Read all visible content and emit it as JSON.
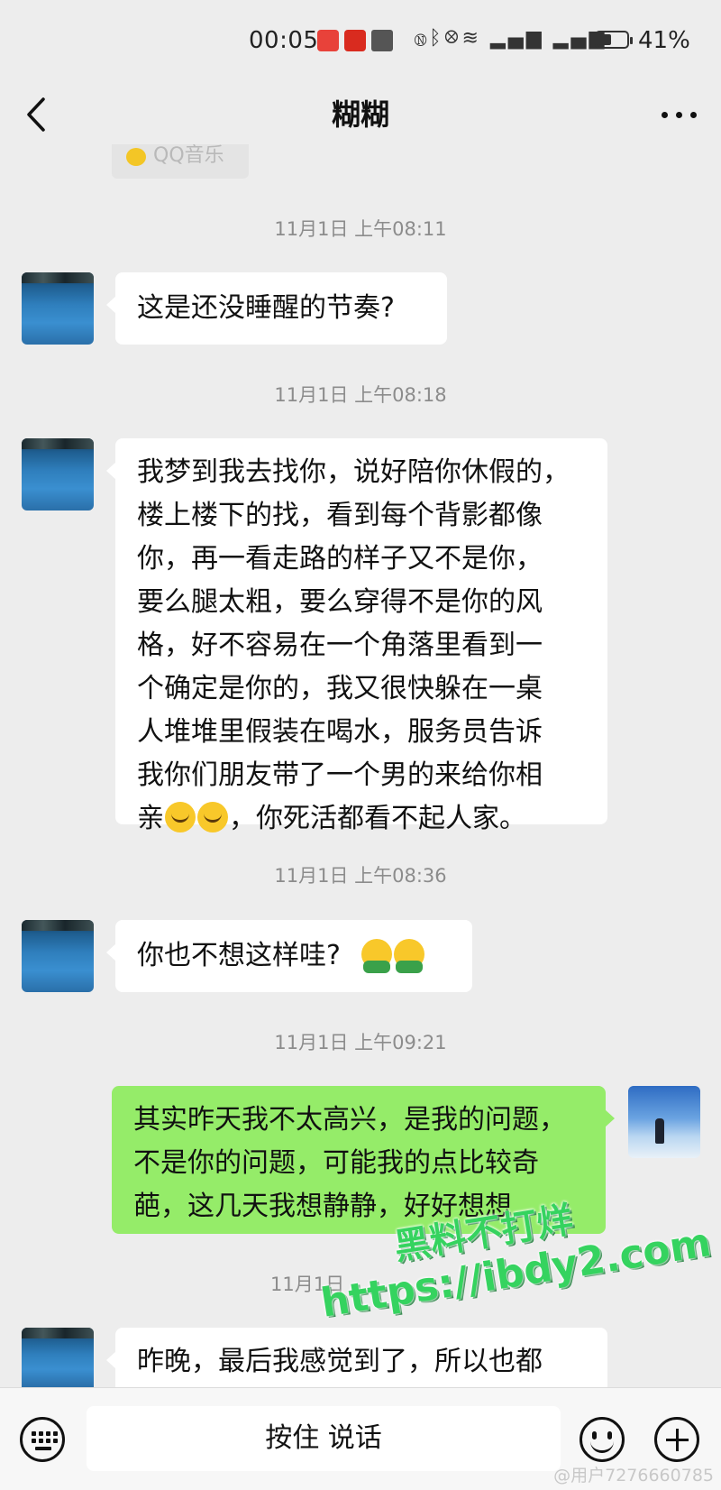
{
  "status_bar": {
    "time": "00:05",
    "battery_percent": "41%",
    "battery_level": 0.41
  },
  "header": {
    "title": "糊糊"
  },
  "partial_card": {
    "label": "QQ音乐"
  },
  "messages": [
    {
      "timestamp": "11月1日 上午08:11",
      "sender": "other",
      "text": "这是还没睡醒的节奏?"
    },
    {
      "timestamp": "11月1日 上午08:18",
      "sender": "other",
      "lines": [
        "我梦到我去找你，说好陪你休假的，",
        "楼上楼下的找，看到每个背影都像",
        "你，再一看走路的样子又不是你，",
        "要么腿太粗，要么穿得不是你的风",
        "格，好不容易在一个角落里看到一",
        "个确定是你的，我又很快躲在一桌",
        "人堆堆里假装在喝水，服务员告诉",
        "我你们朋友带了一个男的来给你相"
      ],
      "last_line_prefix": "亲",
      "last_line_suffix": "，你死活都看不起人家。",
      "emojis": [
        "loudly-crying-face-emoji",
        "loudly-crying-face-emoji"
      ]
    },
    {
      "timestamp": "11月1日 上午08:36",
      "sender": "other",
      "text": "你也不想这样哇?",
      "emojis": [
        "grinning-face-emoji",
        "grinning-face-emoji"
      ]
    },
    {
      "timestamp": "11月1日 上午09:21",
      "sender": "self",
      "lines": [
        "其实昨天我不太高兴，是我的问题，",
        "不是你的问题，可能我的点比较奇",
        "葩，这几天我想静静，好好想想"
      ]
    },
    {
      "timestamp": "11月1日",
      "sender": "other",
      "lines": [
        "昨晚，最后我感觉到了，所以也都"
      ]
    }
  ],
  "watermark": {
    "line1": "黑料不打烊",
    "line2": "https://ibdy2.com"
  },
  "input_bar": {
    "voice_button_label": "按住 说话"
  },
  "credit": "@用户7276660785"
}
